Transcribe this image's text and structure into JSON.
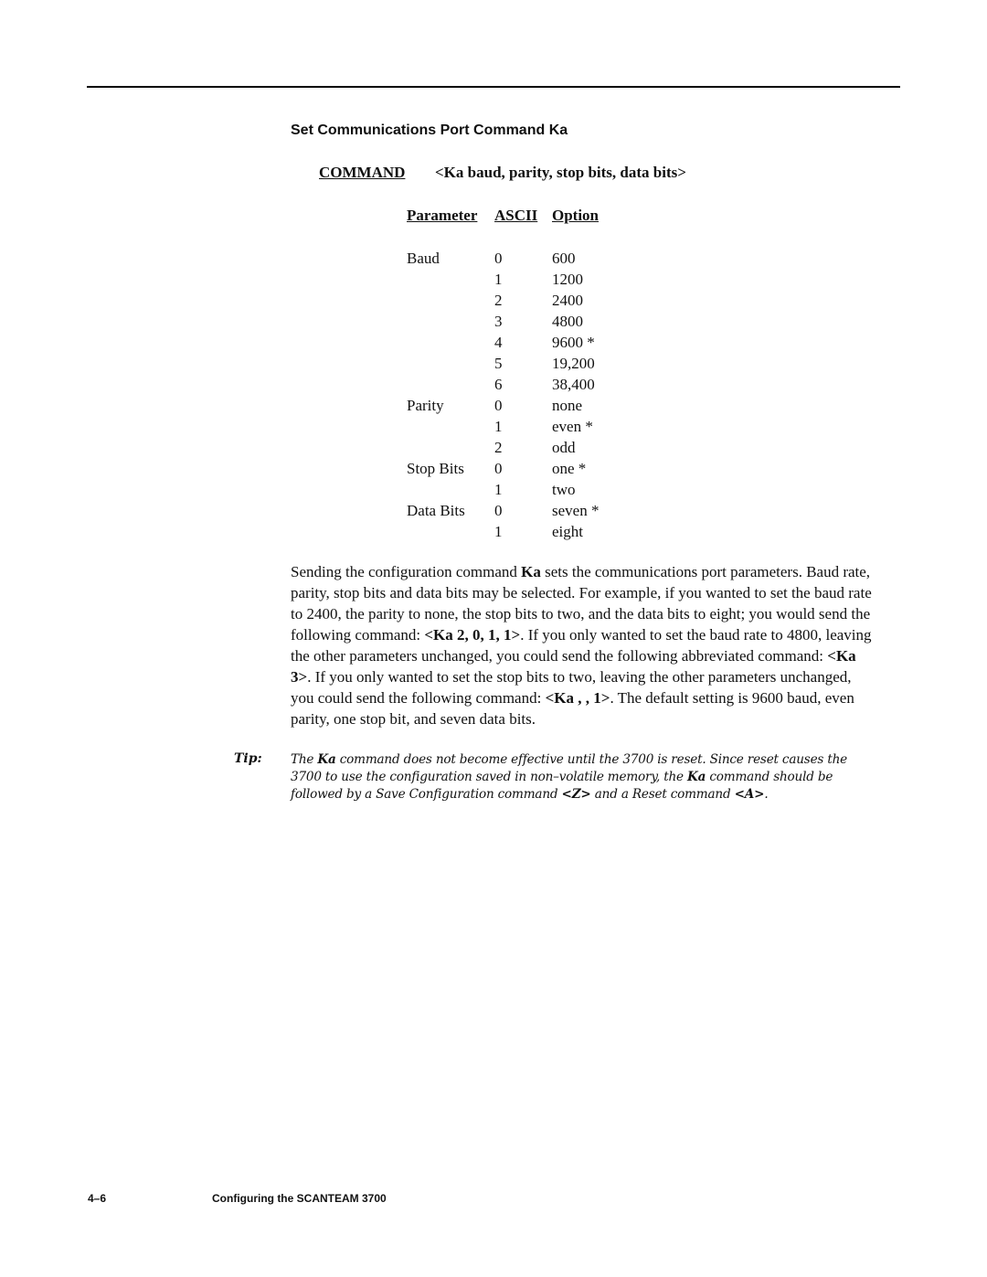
{
  "section_title": "Set Communications Port Command Ka",
  "command": {
    "keyword": "COMMAND",
    "syntax": "<Ka baud, parity, stop bits, data bits>"
  },
  "table": {
    "headers": [
      "Parameter",
      "ASCII",
      "Option"
    ],
    "rows": [
      {
        "parameter": "Baud",
        "ascii": "0",
        "option": "600"
      },
      {
        "parameter": "",
        "ascii": "1",
        "option": "1200"
      },
      {
        "parameter": "",
        "ascii": "2",
        "option": "2400"
      },
      {
        "parameter": "",
        "ascii": "3",
        "option": "4800"
      },
      {
        "parameter": "",
        "ascii": "4",
        "option": "9600 *"
      },
      {
        "parameter": "",
        "ascii": "5",
        "option": "19,200"
      },
      {
        "parameter": "",
        "ascii": "6",
        "option": "38,400"
      },
      {
        "parameter": "Parity",
        "ascii": "0",
        "option": "none"
      },
      {
        "parameter": "",
        "ascii": "1",
        "option": "even *"
      },
      {
        "parameter": "",
        "ascii": "2",
        "option": "odd"
      },
      {
        "parameter": "Stop Bits",
        "ascii": "0",
        "option": "one *"
      },
      {
        "parameter": "",
        "ascii": "1",
        "option": "two"
      },
      {
        "parameter": "Data Bits",
        "ascii": "0",
        "option": "seven *"
      },
      {
        "parameter": "",
        "ascii": "1",
        "option": "eight"
      }
    ]
  },
  "paragraph": {
    "p1": "Sending the configuration command ",
    "b1": "Ka",
    "p2": " sets the communications port parameters.  Baud rate, parity, stop bits and data bits may be selected.  For example, if you wanted to set the baud rate to 2400, the parity to none, the stop bits to two, and the data bits to eight; you would send the following command:  ",
    "b2": "<Ka 2, 0, 1, 1>",
    "p3": ".  If you only wanted to set the baud rate to 4800, leaving the other parameters unchanged, you could send the following abbreviated command:  ",
    "b3": "<Ka 3>",
    "p4": ".   If you only wanted to set the stop bits to two, leaving the other parameters unchanged, you could send the following command:  ",
    "b4": "<Ka , , 1>",
    "p5": ". The default setting is 9600 baud, even parity, one stop bit, and seven data bits."
  },
  "tip": {
    "label": "Tip:",
    "t1": "The ",
    "b1": "Ka",
    "t2": " command does not become effective until the 3700 is reset.  Since reset causes the 3700 to use the configuration saved in non–volatile memory, the ",
    "b2": "Ka",
    "t3": " command should be followed by a Save Configuration command ",
    "b3": "<Z>",
    "t4": " and a Reset command ",
    "b4": "<A>",
    "t5": "."
  },
  "footer": {
    "page_number": "4–6",
    "title": "Configuring the SCANTEAM 3700"
  }
}
